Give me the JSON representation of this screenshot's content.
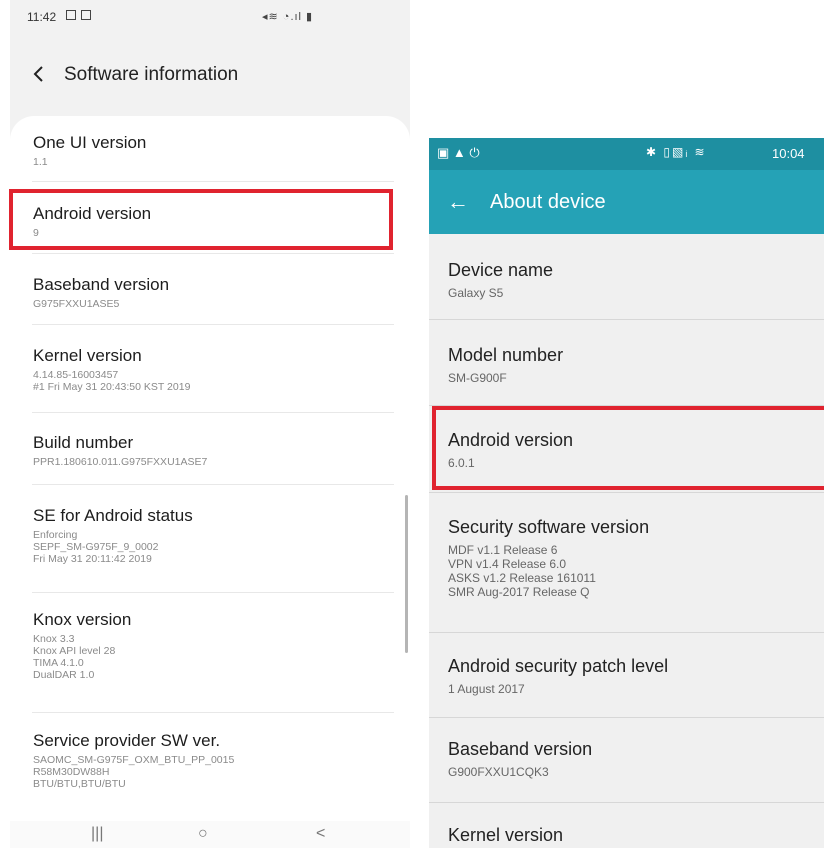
{
  "left_phone": {
    "status_time": "11:42",
    "status_icons": "◂≋ ◔.ıl ▮",
    "title": "Software information",
    "items": [
      {
        "label": "One UI version",
        "value": "1.1"
      },
      {
        "label": "Android version",
        "value": "9"
      },
      {
        "label": "Baseband version",
        "value": "G975FXXU1ASE5"
      },
      {
        "label": "Kernel version",
        "value": "4.14.85-16003457\n#1 Fri May 31 20:43:50 KST 2019"
      },
      {
        "label": "Build number",
        "value": "PPR1.180610.011.G975FXXU1ASE7"
      },
      {
        "label": "SE for Android status",
        "value": "Enforcing\nSEPF_SM-G975F_9_0002\nFri May 31 20:11:42 2019"
      },
      {
        "label": "Knox version",
        "value": "Knox 3.3\nKnox API level 28\nTIMA 4.1.0\nDualDAR 1.0"
      },
      {
        "label": "Service provider SW ver.",
        "value": "SAOMC_SM-G975F_OXM_BTU_PP_0015\nR58M30DW88H\nBTU/BTU,BTU/BTU"
      }
    ],
    "nav": {
      "recents": "|||",
      "home": "○",
      "back": "<"
    }
  },
  "right_phone": {
    "status_time": "10:04",
    "status_left_icons": "▣ ▲ ⏻",
    "status_mid_icons": "✱ ▯▧ᵢ ≋",
    "title": "About device",
    "items": [
      {
        "label": "Device name",
        "value": "Galaxy S5"
      },
      {
        "label": "Model number",
        "value": "SM-G900F"
      },
      {
        "label": "Android version",
        "value": "6.0.1"
      },
      {
        "label": "Security software version",
        "value": "MDF v1.1 Release 6\nVPN v1.4 Release 6.0\nASKS v1.2 Release 161011\nSMR Aug-2017 Release Q"
      },
      {
        "label": "Android security patch level",
        "value": "1 August 2017"
      },
      {
        "label": "Baseband version",
        "value": "G900FXXU1CQK3"
      },
      {
        "label": "Kernel version",
        "value": ""
      }
    ]
  },
  "colors": {
    "highlight": "#e0232f",
    "teal_appbar": "#25a2b6",
    "teal_status": "#1e8fa1"
  }
}
